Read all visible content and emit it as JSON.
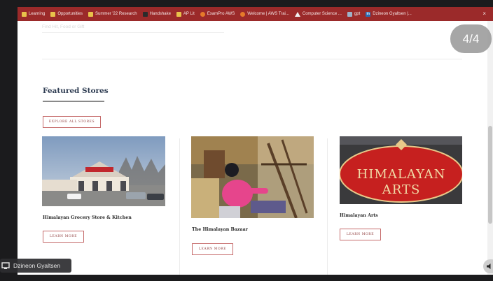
{
  "bookmarks": [
    {
      "label": "Learning",
      "icon": "folder-icon"
    },
    {
      "label": "Opportunities",
      "icon": "folder-icon"
    },
    {
      "label": "Summer '22 Research",
      "icon": "folder-icon"
    },
    {
      "label": "Handshake",
      "icon": "handshake-icon"
    },
    {
      "label": "AP Lit",
      "icon": "folder-icon"
    },
    {
      "label": "ExamPro AWS",
      "icon": "exampro-icon"
    },
    {
      "label": "Welcome | AWS Trai...",
      "icon": "aws-icon"
    },
    {
      "label": "Computer Science ...",
      "icon": "drive-icon"
    },
    {
      "label": "gpt",
      "icon": "gpt-icon"
    },
    {
      "label": "Dzineon Gyaltsen |...",
      "icon": "linkedin-icon"
    }
  ],
  "bookmarks_close": "×",
  "faded_input": "Find Hit, Food or Gift",
  "section_title": "Featured Stores",
  "explore_button": "Explore All Stores",
  "stores": [
    {
      "name": "Himalayan Grocery Store & Kitchen",
      "button": "Learn More",
      "image_sign": "HIMALAYAN GROCERY"
    },
    {
      "name": "The Himalayan Bazaar",
      "button": "Learn More"
    },
    {
      "name": "Himalayan Arts",
      "button": "Learn More",
      "sign_line1": "HIMALAYAN",
      "sign_line2": "ARTS"
    }
  ],
  "slide_counter": "4/4",
  "participant_name": "Dzineon Gyaltsen",
  "colors": {
    "bookmarks_bar": "#9b2a2a",
    "accent_border": "#c56a6a",
    "title_text": "#2e3c52"
  }
}
